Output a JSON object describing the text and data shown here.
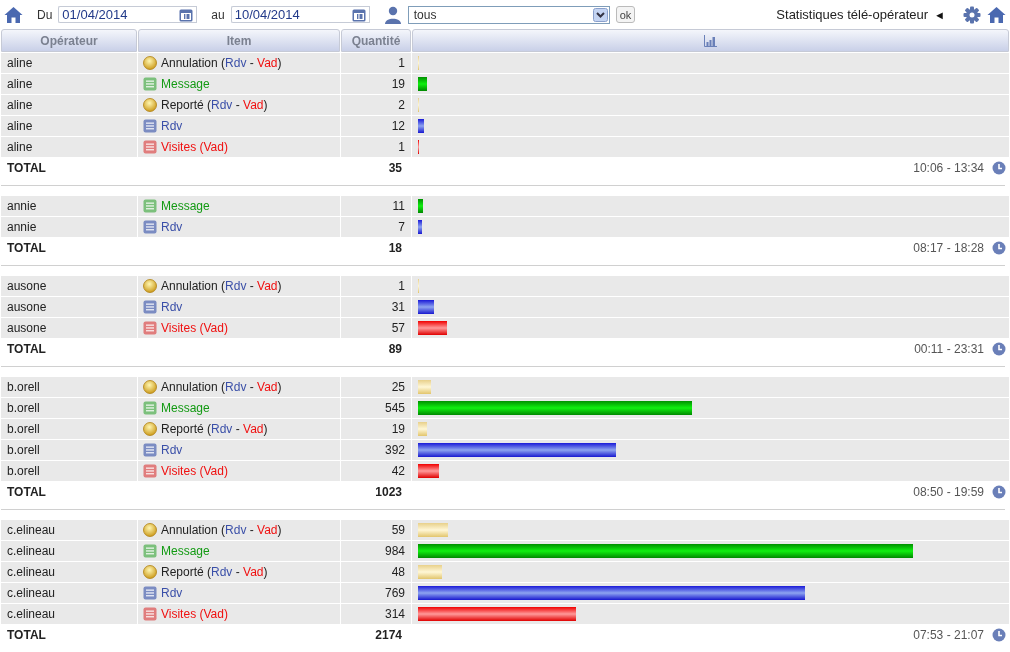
{
  "toolbar": {
    "from_label": "Du",
    "from_date": "01/04/2014",
    "to_label": "au",
    "to_date": "10/04/2014",
    "operator_select": "tous",
    "ok_button": "ok",
    "title": "Statistiques télé-opérateur",
    "title_toggle": "◄"
  },
  "table": {
    "columns": [
      "Opérateur",
      "Item",
      "Quantité"
    ],
    "groups": [
      {
        "rows": [
          {
            "operator": "aline",
            "kind": "event",
            "item": [
              {
                "text": "Annulation ("
              },
              {
                "text": "Rdv",
                "color": "#3a4fa8"
              },
              {
                "text": " - "
              },
              {
                "text": "Vad",
                "color": "#f01010"
              },
              {
                "text": ")"
              }
            ],
            "quantity": "1",
            "level": 0.001
          },
          {
            "operator": "aline",
            "kind": "message",
            "item": [
              {
                "text": "Message",
                "color": "#129a12"
              }
            ],
            "quantity": "19",
            "level": 0.016
          },
          {
            "operator": "aline",
            "kind": "event",
            "item": [
              {
                "text": "Reporté ("
              },
              {
                "text": "Rdv",
                "color": "#3a4fa8"
              },
              {
                "text": " - "
              },
              {
                "text": "Vad",
                "color": "#f01010"
              },
              {
                "text": ")"
              }
            ],
            "quantity": "2",
            "level": 0.002
          },
          {
            "operator": "aline",
            "kind": "rdv",
            "item": [
              {
                "text": "Rdv",
                "color": "#3a4fa8"
              }
            ],
            "quantity": "12",
            "level": 0.01
          },
          {
            "operator": "aline",
            "kind": "visit",
            "item": [
              {
                "text": "Visites (Vad)",
                "color": "#f01010"
              }
            ],
            "quantity": "1",
            "level": 0.001
          }
        ],
        "total_label": "TOTAL",
        "total": "35",
        "time_range": "10:06 - 13:34"
      },
      {
        "rows": [
          {
            "operator": "annie",
            "kind": "message",
            "item": [
              {
                "text": "Message",
                "color": "#129a12"
              }
            ],
            "quantity": "11",
            "level": 0.009
          },
          {
            "operator": "annie",
            "kind": "rdv",
            "item": [
              {
                "text": "Rdv",
                "color": "#3a4fa8"
              }
            ],
            "quantity": "7",
            "level": 0.006
          }
        ],
        "total_label": "TOTAL",
        "total": "18",
        "time_range": "08:17 - 18:28"
      },
      {
        "rows": [
          {
            "operator": "ausone",
            "kind": "event",
            "item": [
              {
                "text": "Annulation ("
              },
              {
                "text": "Rdv",
                "color": "#3a4fa8"
              },
              {
                "text": " - "
              },
              {
                "text": "Vad",
                "color": "#f01010"
              },
              {
                "text": ")"
              }
            ],
            "quantity": "1",
            "level": 0.001
          },
          {
            "operator": "ausone",
            "kind": "rdv",
            "item": [
              {
                "text": "Rdv",
                "color": "#3a4fa8"
              }
            ],
            "quantity": "31",
            "level": 0.027
          },
          {
            "operator": "ausone",
            "kind": "visit",
            "item": [
              {
                "text": "Visites (Vad)",
                "color": "#f01010"
              }
            ],
            "quantity": "57",
            "level": 0.049
          }
        ],
        "total_label": "TOTAL",
        "total": "89",
        "time_range": "00:11 - 23:31"
      },
      {
        "rows": [
          {
            "operator": "b.orell",
            "kind": "event",
            "item": [
              {
                "text": "Annulation ("
              },
              {
                "text": "Rdv",
                "color": "#3a4fa8"
              },
              {
                "text": " - "
              },
              {
                "text": "Vad",
                "color": "#f01010"
              },
              {
                "text": ")"
              }
            ],
            "quantity": "25",
            "level": 0.022
          },
          {
            "operator": "b.orell",
            "kind": "message",
            "item": [
              {
                "text": "Message",
                "color": "#129a12"
              }
            ],
            "quantity": "545",
            "level": 0.469
          },
          {
            "operator": "b.orell",
            "kind": "event",
            "item": [
              {
                "text": "Reporté ("
              },
              {
                "text": "Rdv",
                "color": "#3a4fa8"
              },
              {
                "text": " - "
              },
              {
                "text": "Vad",
                "color": "#f01010"
              },
              {
                "text": ")"
              }
            ],
            "quantity": "19",
            "level": 0.016
          },
          {
            "operator": "b.orell",
            "kind": "rdv",
            "item": [
              {
                "text": "Rdv",
                "color": "#3a4fa8"
              }
            ],
            "quantity": "392",
            "level": 0.338
          },
          {
            "operator": "b.orell",
            "kind": "visit",
            "item": [
              {
                "text": "Visites (Vad)",
                "color": "#f01010"
              }
            ],
            "quantity": "42",
            "level": 0.036
          }
        ],
        "total_label": "TOTAL",
        "total": "1023",
        "time_range": "08:50 - 19:59"
      },
      {
        "rows": [
          {
            "operator": "c.elineau",
            "kind": "event",
            "item": [
              {
                "text": "Annulation ("
              },
              {
                "text": "Rdv",
                "color": "#3a4fa8"
              },
              {
                "text": " - "
              },
              {
                "text": "Vad",
                "color": "#f01010"
              },
              {
                "text": ")"
              }
            ],
            "quantity": "59",
            "level": 0.051
          },
          {
            "operator": "c.elineau",
            "kind": "message",
            "item": [
              {
                "text": "Message",
                "color": "#129a12"
              }
            ],
            "quantity": "984",
            "level": 0.847
          },
          {
            "operator": "c.elineau",
            "kind": "event",
            "item": [
              {
                "text": "Reporté ("
              },
              {
                "text": "Rdv",
                "color": "#3a4fa8"
              },
              {
                "text": " - "
              },
              {
                "text": "Vad",
                "color": "#f01010"
              },
              {
                "text": ")"
              }
            ],
            "quantity": "48",
            "level": 0.041
          },
          {
            "operator": "c.elineau",
            "kind": "rdv",
            "item": [
              {
                "text": "Rdv",
                "color": "#3a4fa8"
              }
            ],
            "quantity": "769",
            "level": 0.662
          },
          {
            "operator": "c.elineau",
            "kind": "visit",
            "item": [
              {
                "text": "Visites (Vad)",
                "color": "#f01010"
              }
            ],
            "quantity": "314",
            "level": 0.27
          }
        ],
        "total_label": "TOTAL",
        "total": "2174",
        "time_range": "07:53 - 21:07"
      }
    ]
  }
}
